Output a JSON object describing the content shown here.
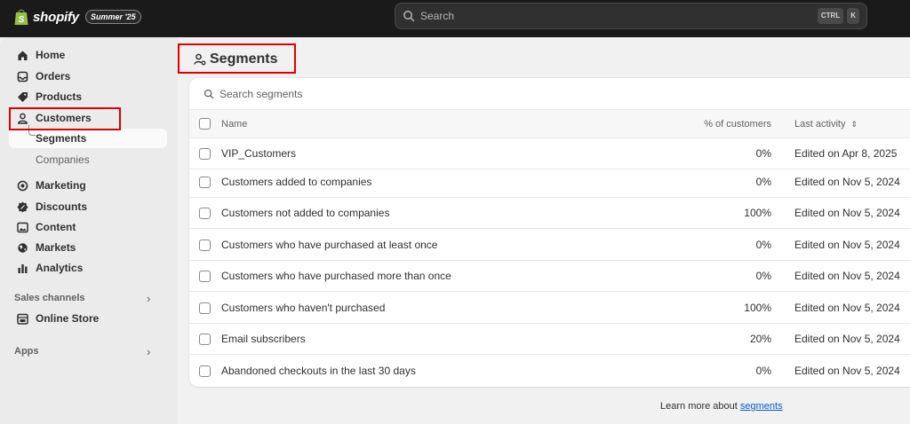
{
  "topbar": {
    "brand": "shopify",
    "edition": "Summer '25",
    "search_placeholder": "Search",
    "shortcut_keys": [
      "CTRL",
      "K"
    ]
  },
  "sidebar": {
    "items": [
      {
        "label": "Home",
        "icon": "home-icon"
      },
      {
        "label": "Orders",
        "icon": "inbox-icon"
      },
      {
        "label": "Products",
        "icon": "tag-icon"
      },
      {
        "label": "Customers",
        "icon": "person-icon"
      }
    ],
    "customer_subitems": [
      "Segments",
      "Companies"
    ],
    "items2": [
      {
        "label": "Marketing",
        "icon": "target-icon"
      },
      {
        "label": "Discounts",
        "icon": "discount-icon"
      },
      {
        "label": "Content",
        "icon": "image-icon"
      },
      {
        "label": "Markets",
        "icon": "globe-icon"
      },
      {
        "label": "Analytics",
        "icon": "bar-chart-icon"
      }
    ],
    "sales_channels_label": "Sales channels",
    "online_store_label": "Online Store",
    "apps_label": "Apps"
  },
  "page": {
    "title": "Segments",
    "search_placeholder": "Search segments",
    "columns": {
      "name": "Name",
      "pct": "% of customers",
      "activity": "Last activity"
    },
    "rows": [
      {
        "name": "VIP_Customers",
        "pct": "0%",
        "activity": "Edited on Apr 8, 2025"
      },
      {
        "name": "Customers added to companies",
        "pct": "0%",
        "activity": "Edited on Nov 5, 2024"
      },
      {
        "name": "Customers not added to companies",
        "pct": "100%",
        "activity": "Edited on Nov 5, 2024"
      },
      {
        "name": "Customers who have purchased at least once",
        "pct": "0%",
        "activity": "Edited on Nov 5, 2024"
      },
      {
        "name": "Customers who have purchased more than once",
        "pct": "0%",
        "activity": "Edited on Nov 5, 2024"
      },
      {
        "name": "Customers who haven't purchased",
        "pct": "100%",
        "activity": "Edited on Nov 5, 2024"
      },
      {
        "name": "Email subscribers",
        "pct": "20%",
        "activity": "Edited on Nov 5, 2024"
      },
      {
        "name": "Abandoned checkouts in the last 30 days",
        "pct": "0%",
        "activity": "Edited on Nov 5, 2024"
      }
    ],
    "learn_text": "Learn more about",
    "learn_link": "segments"
  },
  "colors": {
    "highlight": "#e00000",
    "topbar": "#1a1a1a",
    "brand_green": "#95bf47",
    "link": "#005bd3"
  }
}
